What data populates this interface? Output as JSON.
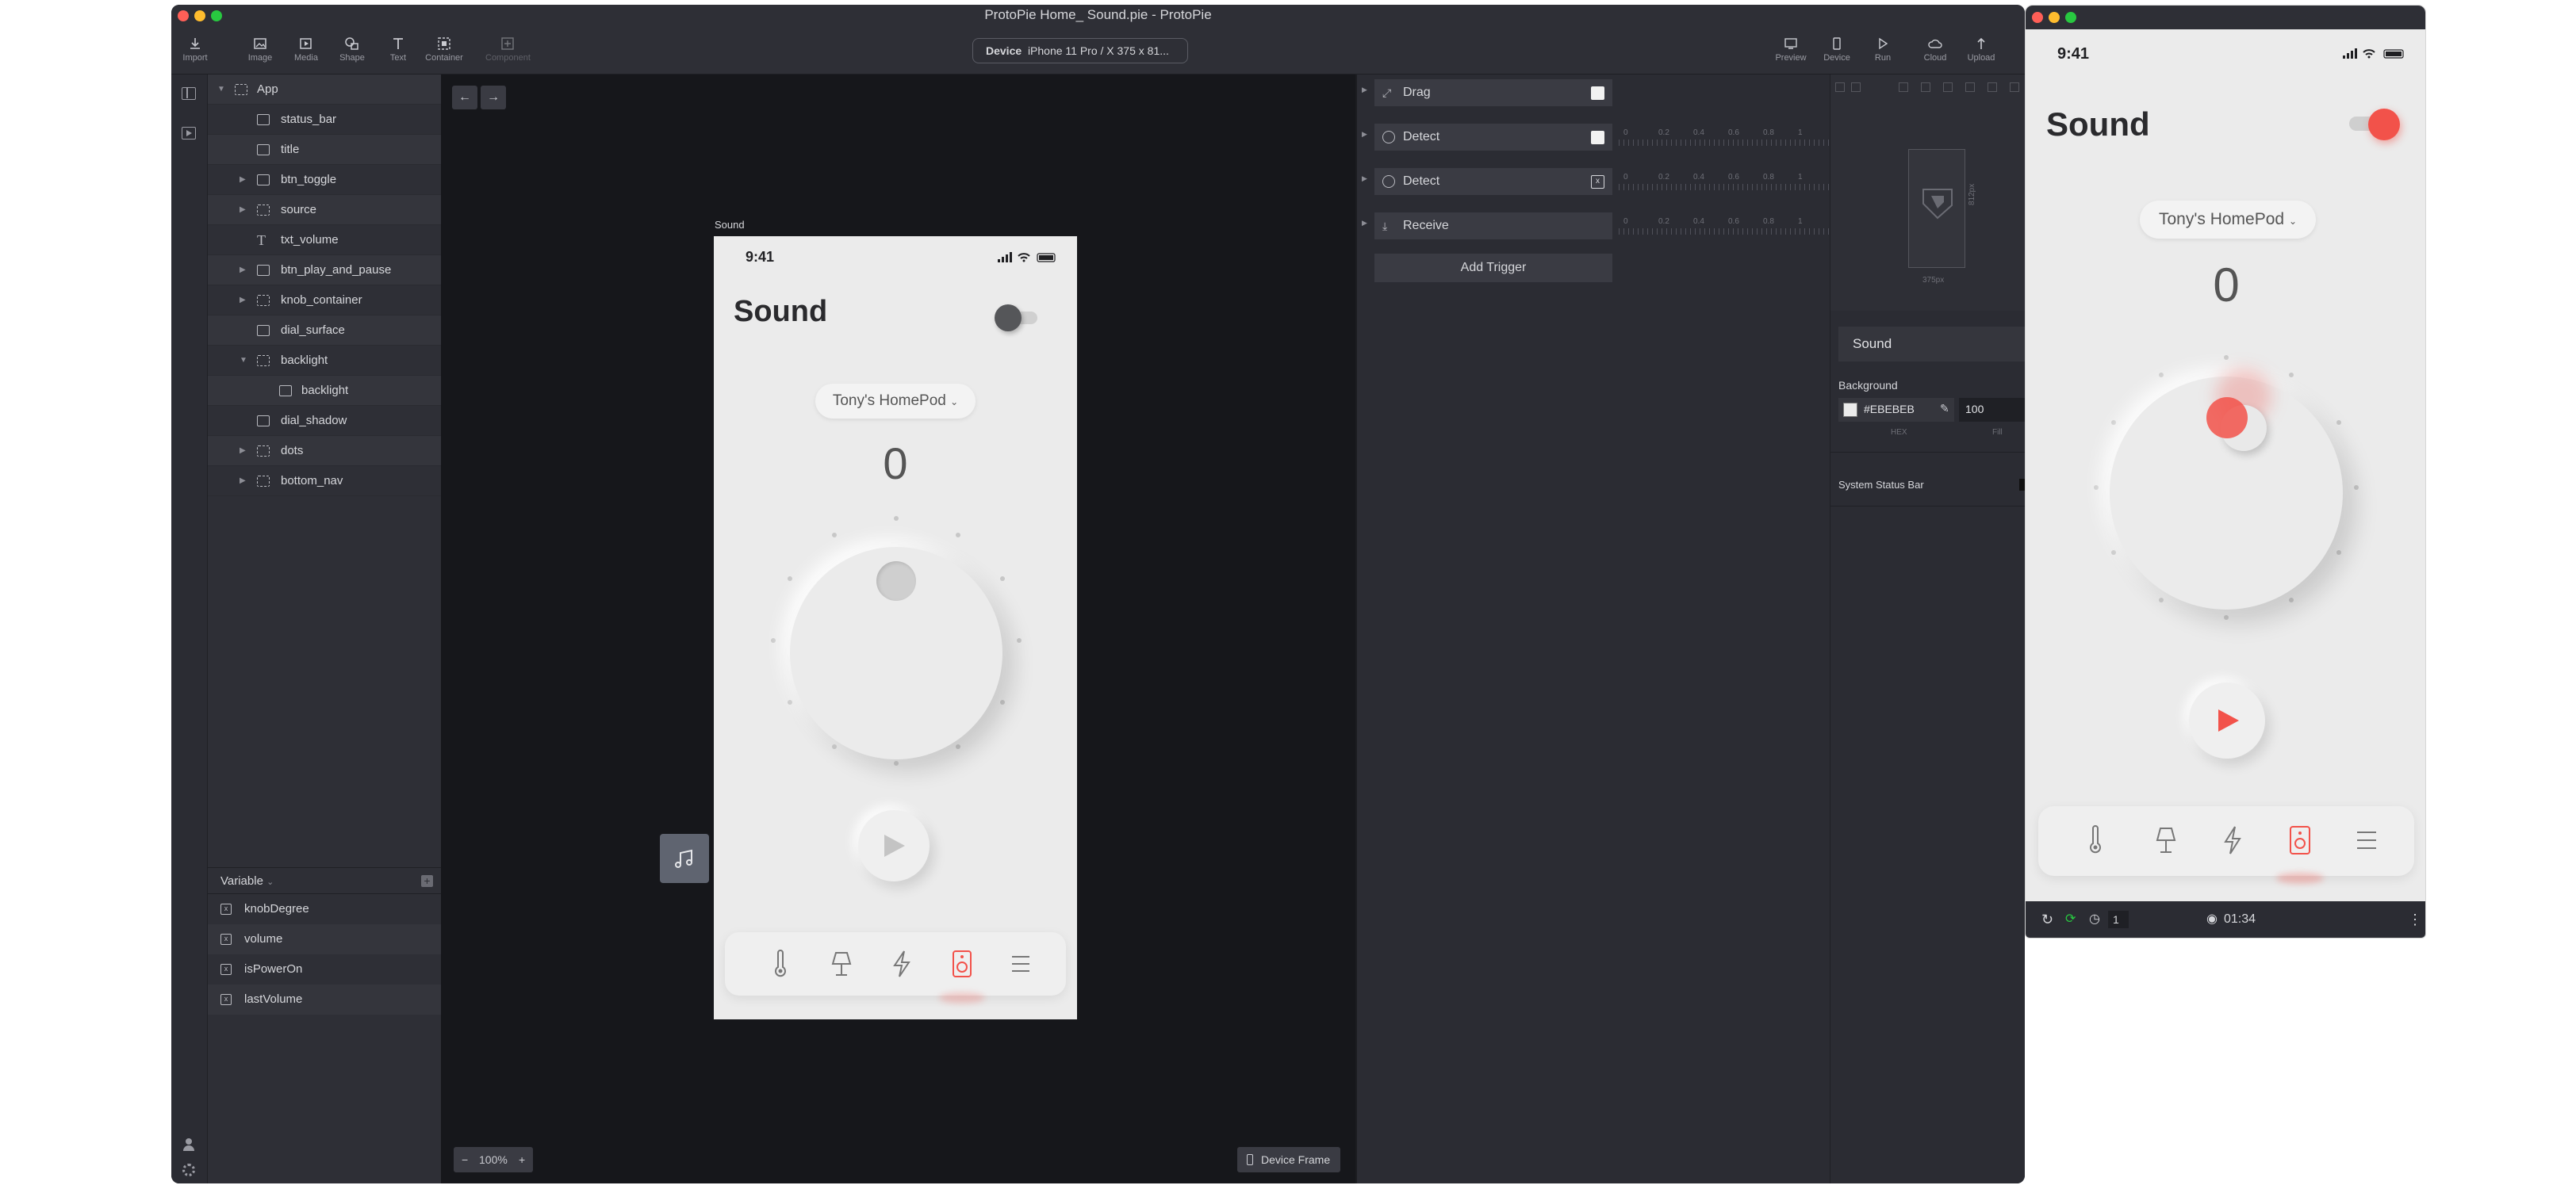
{
  "window": {
    "title": "ProtoPie Home_ Sound.pie - ProtoPie"
  },
  "toolbar": {
    "import": "Import",
    "image": "Image",
    "media": "Media",
    "shape": "Shape",
    "text": "Text",
    "container": "Container",
    "component": "Component",
    "device_label": "Device",
    "device_value": "iPhone 11 Pro / X  375 x 81...",
    "preview": "Preview",
    "device": "Device",
    "run": "Run",
    "cloud": "Cloud",
    "upload": "Upload"
  },
  "layers": [
    {
      "name": "App",
      "icon": "container-icon"
    },
    {
      "name": "status_bar",
      "icon": "image-icon"
    },
    {
      "name": "title",
      "icon": "image-icon"
    },
    {
      "name": "btn_toggle",
      "icon": "component-icon"
    },
    {
      "name": "source",
      "icon": "container-icon"
    },
    {
      "name": "txt_volume",
      "icon": "text-icon"
    },
    {
      "name": "btn_play_and_pause",
      "icon": "component-icon"
    },
    {
      "name": "knob_container",
      "icon": "container-icon"
    },
    {
      "name": "dial_surface",
      "icon": "image-icon"
    },
    {
      "name": "backlight",
      "icon": "container-icon"
    },
    {
      "name": "backlight",
      "icon": "image-icon"
    },
    {
      "name": "dial_shadow",
      "icon": "image-icon"
    },
    {
      "name": "dots",
      "icon": "container-icon"
    },
    {
      "name": "bottom_nav",
      "icon": "container-icon"
    }
  ],
  "variables": {
    "header": "Variable",
    "items": [
      "knobDegree",
      "volume",
      "isPowerOn",
      "lastVolume"
    ]
  },
  "canvas": {
    "scene_label": "Sound",
    "zoom": "100%",
    "device_frame": "Device Frame"
  },
  "phone": {
    "time": "9:41",
    "title": "Sound",
    "source": "Tony's HomePod",
    "volume": "0"
  },
  "triggers": {
    "items": [
      "Drag",
      "Detect",
      "Detect",
      "Receive"
    ],
    "ticks": [
      "0",
      "0.2",
      "0.4",
      "0.6",
      "0.8",
      "1"
    ],
    "add_label": "Add Trigger"
  },
  "properties": {
    "width_label": "375px",
    "height_label": "812px",
    "scene_name": "Sound",
    "background_label": "Background",
    "hex_value": "#EBEBEB",
    "fill_value": "100",
    "hex_caption": "HEX",
    "fill_caption": "Fill",
    "status_bar_label": "System Status Bar"
  },
  "preview": {
    "time": "9:41",
    "title": "Sound",
    "source": "Tony's HomePod",
    "volume": "0",
    "speed": "1",
    "timer": "01:34"
  },
  "colors": {
    "accent": "#f2524a",
    "panel": "#2b2c33",
    "phone_bg": "#ebebeb"
  }
}
